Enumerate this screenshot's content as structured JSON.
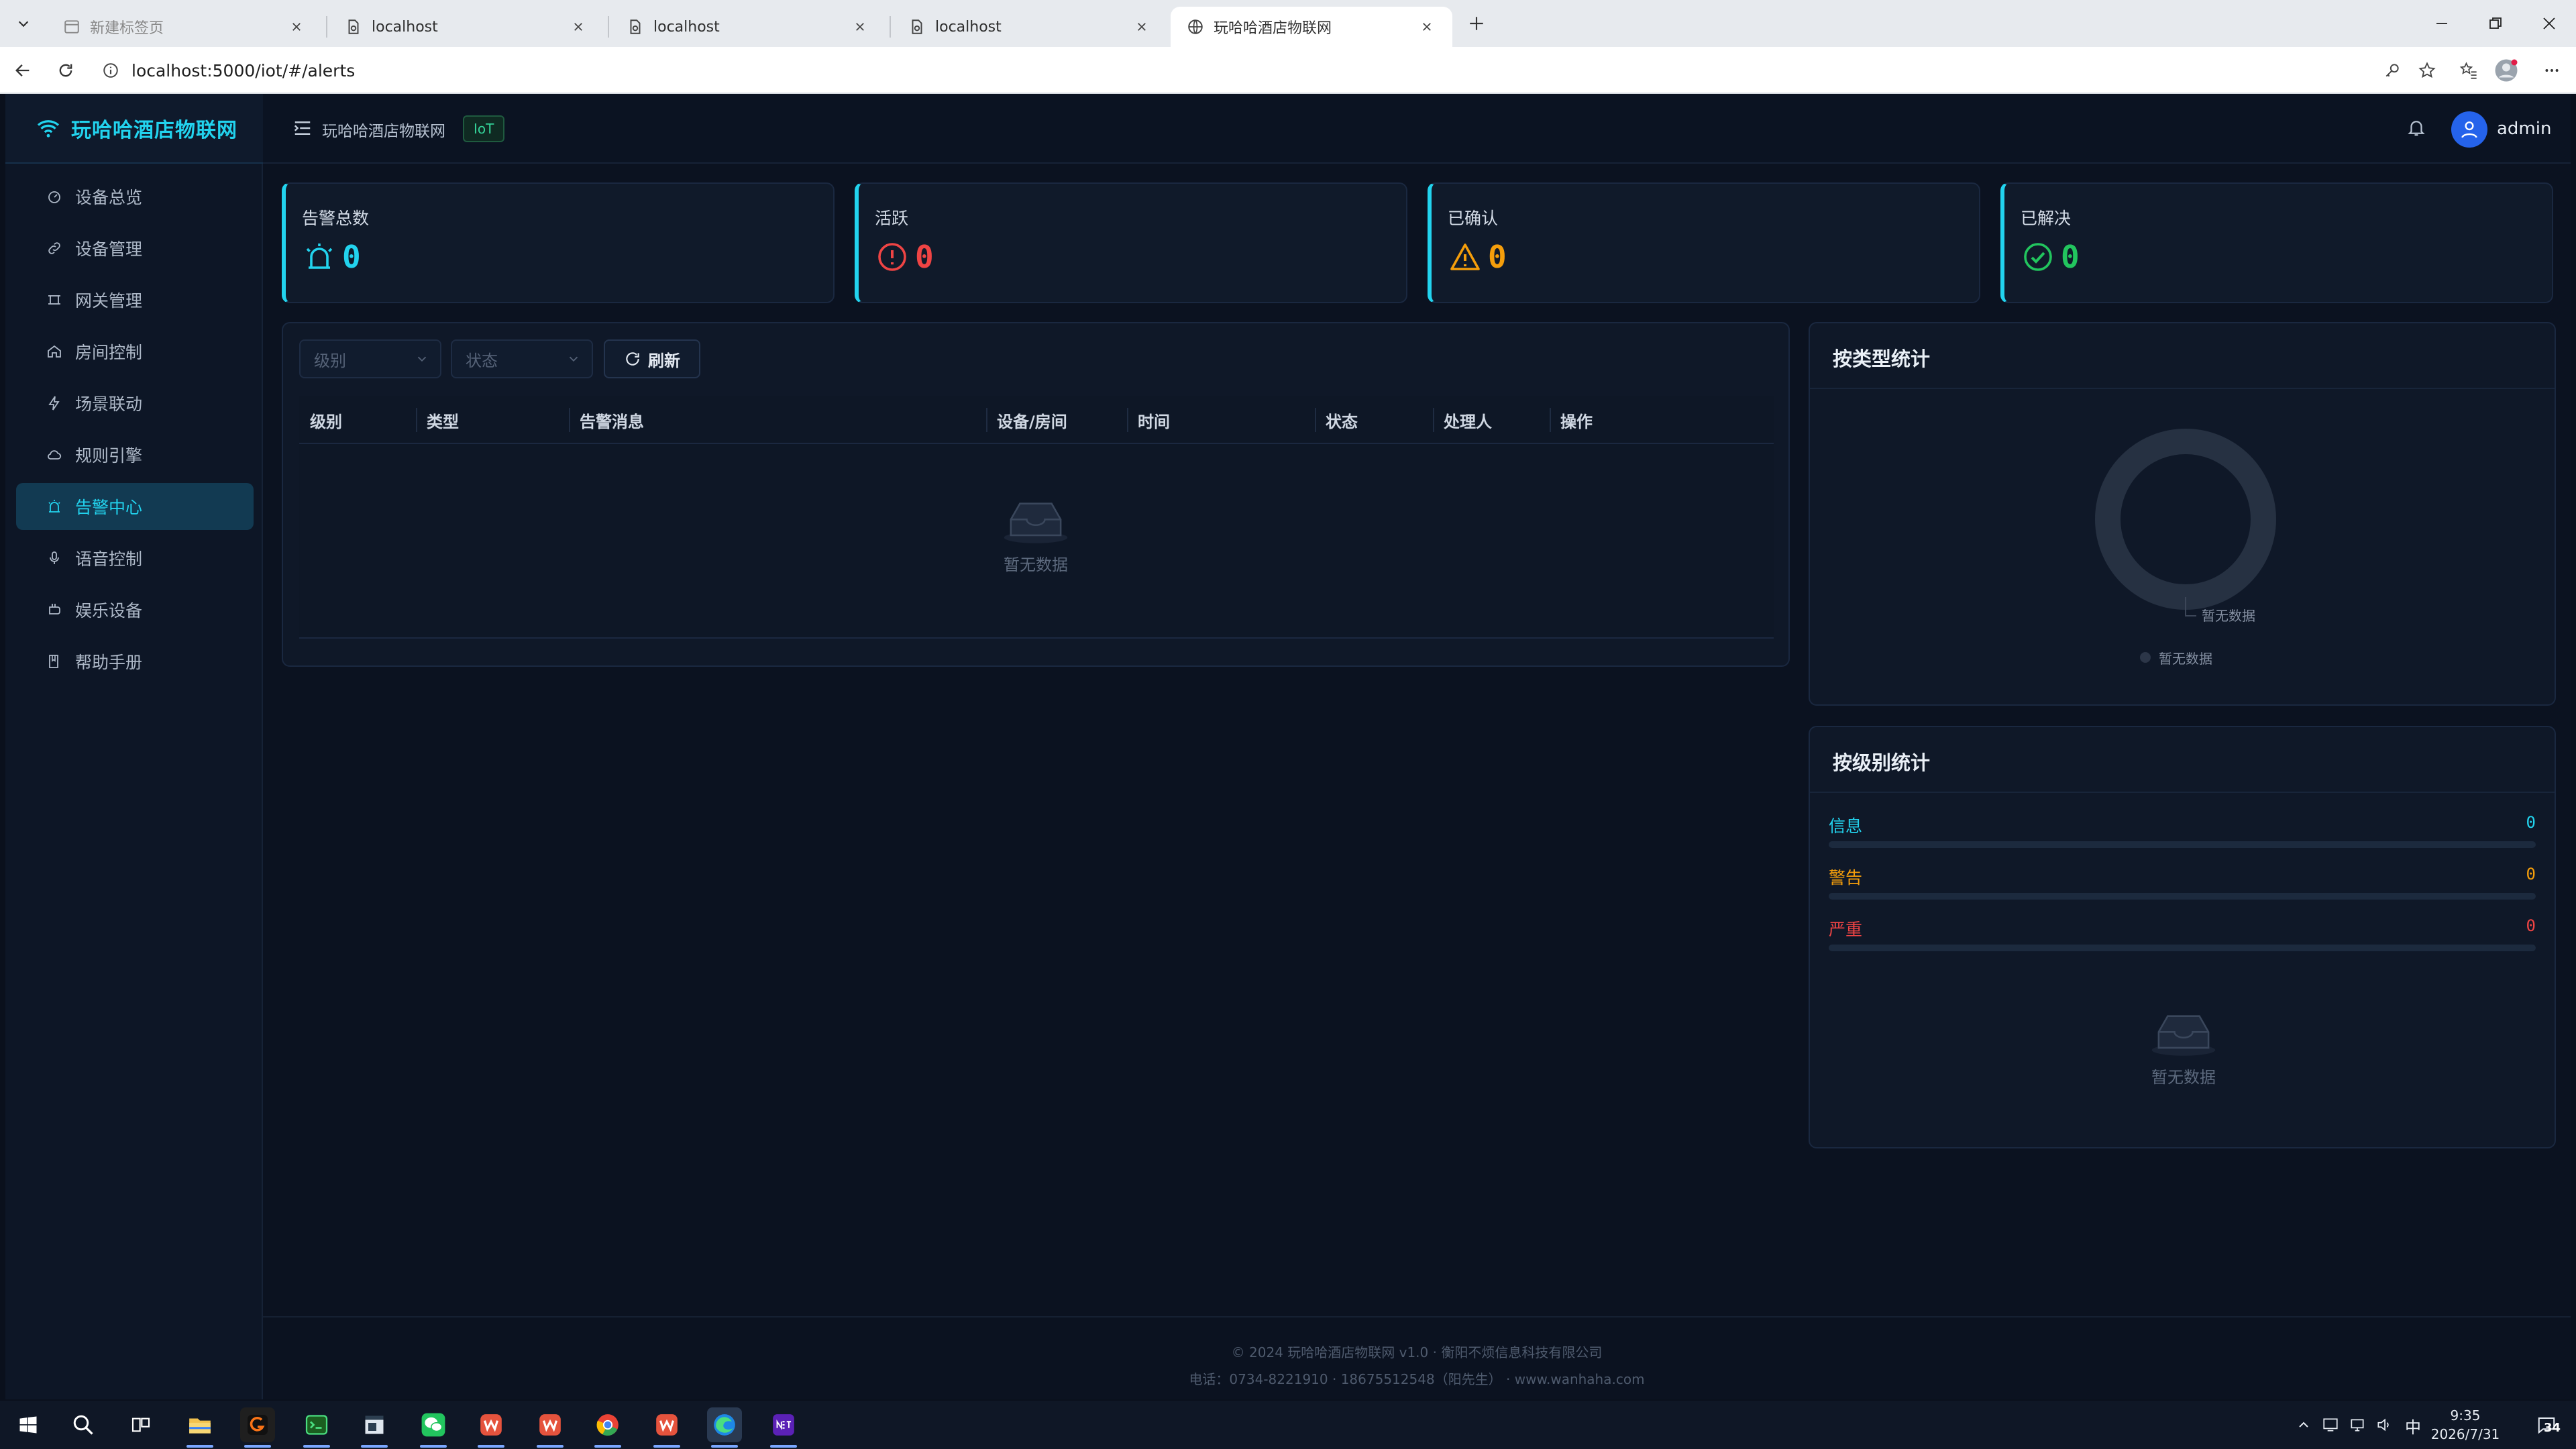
{
  "browser": {
    "tabs": [
      {
        "title": "新建标签页",
        "state": "inactive",
        "icon": "new-tab-page-icon"
      },
      {
        "title": "localhost",
        "state": "inactive",
        "icon": "page-icon"
      },
      {
        "title": "localhost",
        "state": "inactive",
        "icon": "page-icon"
      },
      {
        "title": "localhost",
        "state": "inactive",
        "icon": "page-icon"
      },
      {
        "title": "玩哈哈酒店物联网",
        "state": "active",
        "icon": "globe-icon"
      }
    ],
    "url": "localhost:5000/iot/#/alerts"
  },
  "app": {
    "brand": "玩哈哈酒店物联网",
    "accent_color": "#22d3ee",
    "menu": [
      {
        "label": "设备总览",
        "icon": "dashboard-icon"
      },
      {
        "label": "设备管理",
        "icon": "link-icon"
      },
      {
        "label": "网关管理",
        "icon": "gateway-icon"
      },
      {
        "label": "房间控制",
        "icon": "home-icon"
      },
      {
        "label": "场景联动",
        "icon": "lightning-icon"
      },
      {
        "label": "规则引擎",
        "icon": "cloud-icon"
      },
      {
        "label": "告警中心",
        "icon": "alarm-icon",
        "active": true
      },
      {
        "label": "语音控制",
        "icon": "microphone-icon"
      },
      {
        "label": "娱乐设备",
        "icon": "gamepad-icon"
      },
      {
        "label": "帮助手册",
        "icon": "book-icon"
      }
    ],
    "topbar": {
      "title": "玩哈哈酒店物联网",
      "badge": "IoT",
      "username": "admin"
    }
  },
  "stats": [
    {
      "label": "告警总数",
      "value": "0",
      "color": "#22d3ee",
      "icon": "alarm-bell-icon"
    },
    {
      "label": "活跃",
      "value": "0",
      "color": "#ef4444",
      "icon": "exclamation-circle-icon"
    },
    {
      "label": "已确认",
      "value": "0",
      "color": "#f59e0b",
      "icon": "warning-triangle-icon"
    },
    {
      "label": "已解决",
      "value": "0",
      "color": "#22c55e",
      "icon": "check-circle-icon"
    }
  ],
  "alerts_table": {
    "filters": {
      "level_placeholder": "级别",
      "status_placeholder": "状态"
    },
    "refresh_label": "刷新",
    "columns": [
      "级别",
      "类型",
      "告警消息",
      "设备/房间",
      "时间",
      "状态",
      "处理人",
      "操作"
    ],
    "empty_text": "暂无数据"
  },
  "type_stats": {
    "title": "按类型统计",
    "donut_label": "暂无数据",
    "legend_label": "暂无数据"
  },
  "level_stats": {
    "title": "按级别统计",
    "levels": [
      {
        "name": "信息",
        "count": "0",
        "color": "#22d3ee"
      },
      {
        "name": "警告",
        "count": "0",
        "color": "#f59e0b"
      },
      {
        "name": "严重",
        "count": "0",
        "color": "#ef4444"
      }
    ],
    "empty_text": "暂无数据"
  },
  "footer": {
    "line1": "© 2024 玩哈哈酒店物联网 v1.0 · 衡阳不烦信息科技有限公司",
    "line2": "电话：0734-8221910 · 18675512548（阳先生） · www.wanhaha.com"
  },
  "taskbar": {
    "ime": "中",
    "time": "9:35",
    "date": "2026/7/31",
    "notification_count": "34"
  }
}
